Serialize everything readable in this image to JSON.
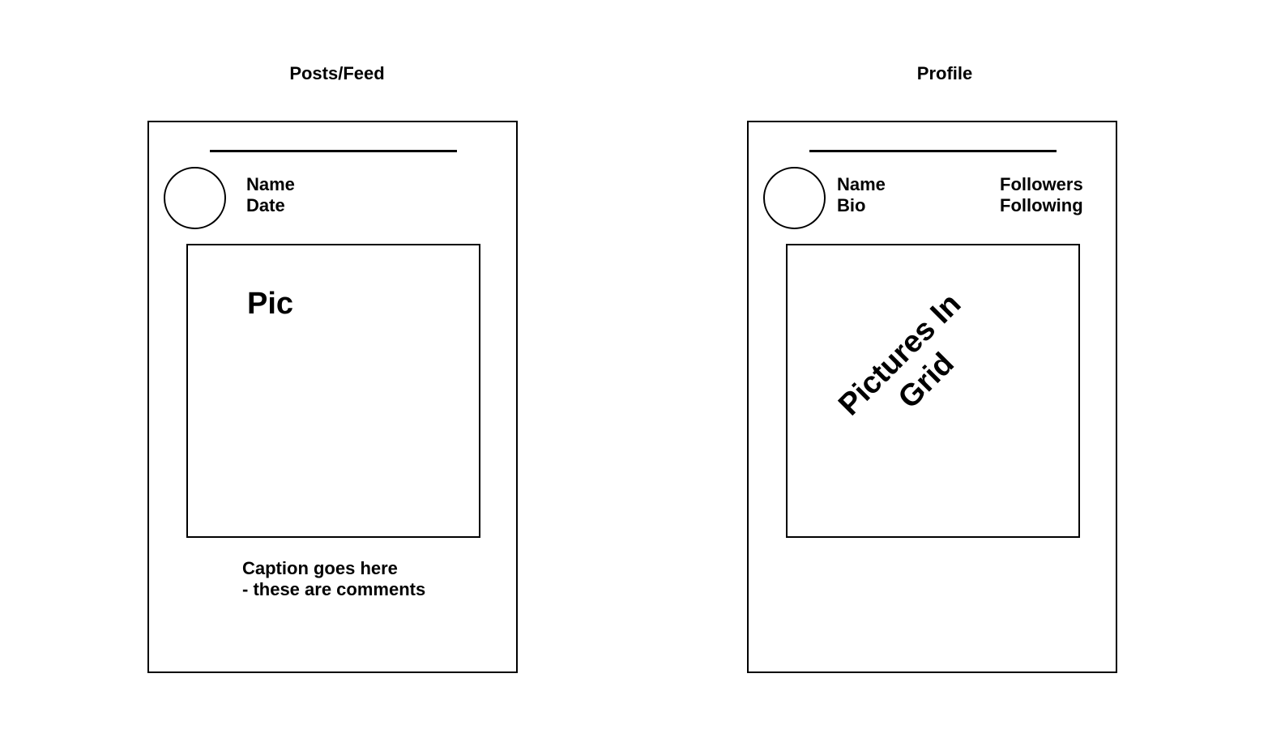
{
  "feed": {
    "title": "Posts/Feed",
    "name": "Name",
    "date": "Date",
    "pic_label": "Pic",
    "caption": "Caption goes here",
    "comments": "- these are comments"
  },
  "profile": {
    "title": "Profile",
    "name": "Name",
    "bio": "Bio",
    "followers": "Followers",
    "following": "Following",
    "grid_label_line1": "Pictures In",
    "grid_label_line2": "Grid"
  }
}
